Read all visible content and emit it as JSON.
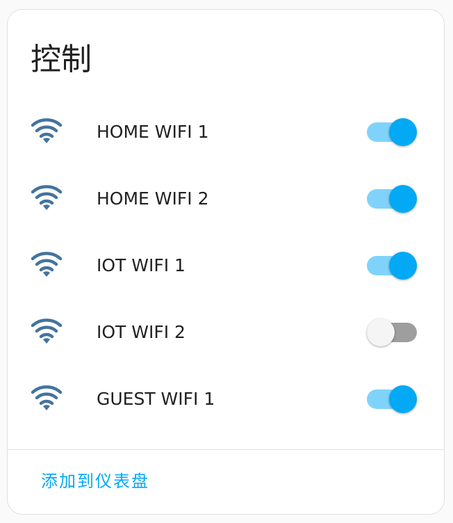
{
  "card": {
    "title": "控制",
    "footer_action": "添加到仪表盘"
  },
  "colors": {
    "accent": "#03a9f4",
    "track_on": "#7fd3fb",
    "track_off": "#9e9e9e",
    "icon": "#44739e"
  },
  "entities": [
    {
      "icon": "wifi-icon",
      "label": "HOME WIFI 1",
      "state": "on"
    },
    {
      "icon": "wifi-icon",
      "label": "HOME WIFI 2",
      "state": "on"
    },
    {
      "icon": "wifi-icon",
      "label": "IOT WIFI 1",
      "state": "on"
    },
    {
      "icon": "wifi-icon",
      "label": "IOT WIFI 2",
      "state": "off"
    },
    {
      "icon": "wifi-icon",
      "label": "GUEST WIFI 1",
      "state": "on"
    }
  ]
}
